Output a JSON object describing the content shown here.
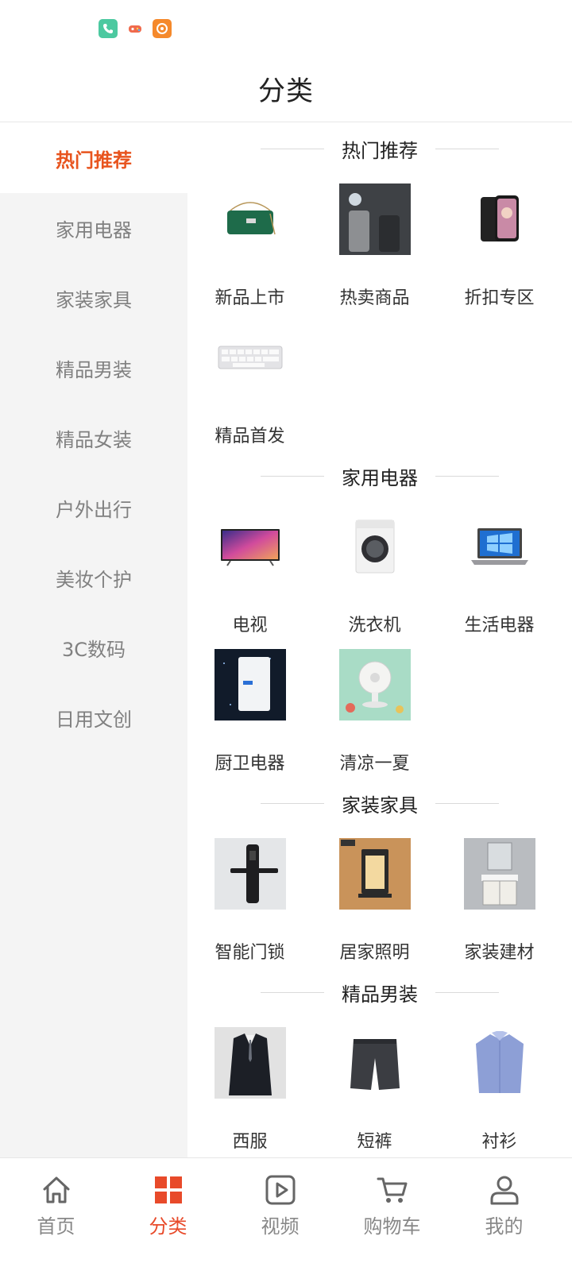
{
  "status_bar": {
    "icons": [
      "phone-icon",
      "game-icon",
      "app-icon"
    ]
  },
  "header": {
    "title": "分类"
  },
  "sidebar": {
    "items": [
      {
        "label": "热门推荐",
        "active": true
      },
      {
        "label": "家用电器",
        "active": false
      },
      {
        "label": "家装家具",
        "active": false
      },
      {
        "label": "精品男装",
        "active": false
      },
      {
        "label": "精品女装",
        "active": false
      },
      {
        "label": "户外出行",
        "active": false
      },
      {
        "label": "美妆个护",
        "active": false
      },
      {
        "label": "3C数码",
        "active": false
      },
      {
        "label": "日用文创",
        "active": false
      }
    ]
  },
  "sections": [
    {
      "title": "热门推荐",
      "items": [
        {
          "label": "新品上市",
          "image": "green-handbag"
        },
        {
          "label": "热卖商品",
          "image": "thermos-bottles"
        },
        {
          "label": "折扣专区",
          "image": "smartphone"
        },
        {
          "label": "精品首发",
          "image": "keyboard"
        }
      ]
    },
    {
      "title": "家用电器",
      "items": [
        {
          "label": "电视",
          "image": "television"
        },
        {
          "label": "洗衣机",
          "image": "washing-machine"
        },
        {
          "label": "生活电器",
          "image": "laptop"
        },
        {
          "label": "厨卫电器",
          "image": "water-heater"
        },
        {
          "label": "清凉一夏",
          "image": "desk-fan"
        }
      ]
    },
    {
      "title": "家装家具",
      "items": [
        {
          "label": "智能门锁",
          "image": "smart-lock"
        },
        {
          "label": "居家照明",
          "image": "wall-lamp"
        },
        {
          "label": "家装建材",
          "image": "bathroom-cabinet"
        }
      ]
    },
    {
      "title": "精品男装",
      "items": [
        {
          "label": "西服",
          "image": "suit"
        },
        {
          "label": "短裤",
          "image": "shorts"
        },
        {
          "label": "衬衫",
          "image": "shirt"
        }
      ]
    }
  ],
  "tabbar": {
    "tabs": [
      {
        "label": "首页",
        "icon": "home-icon",
        "active": false
      },
      {
        "label": "分类",
        "icon": "category-grid-icon",
        "active": true
      },
      {
        "label": "视频",
        "icon": "video-play-icon",
        "active": false
      },
      {
        "label": "购物车",
        "icon": "cart-icon",
        "active": false
      },
      {
        "label": "我的",
        "icon": "user-icon",
        "active": false
      }
    ]
  },
  "colors": {
    "accent": "#e8541e",
    "tab_active": "#e84a2a",
    "sidebar_bg": "#f4f4f4"
  }
}
